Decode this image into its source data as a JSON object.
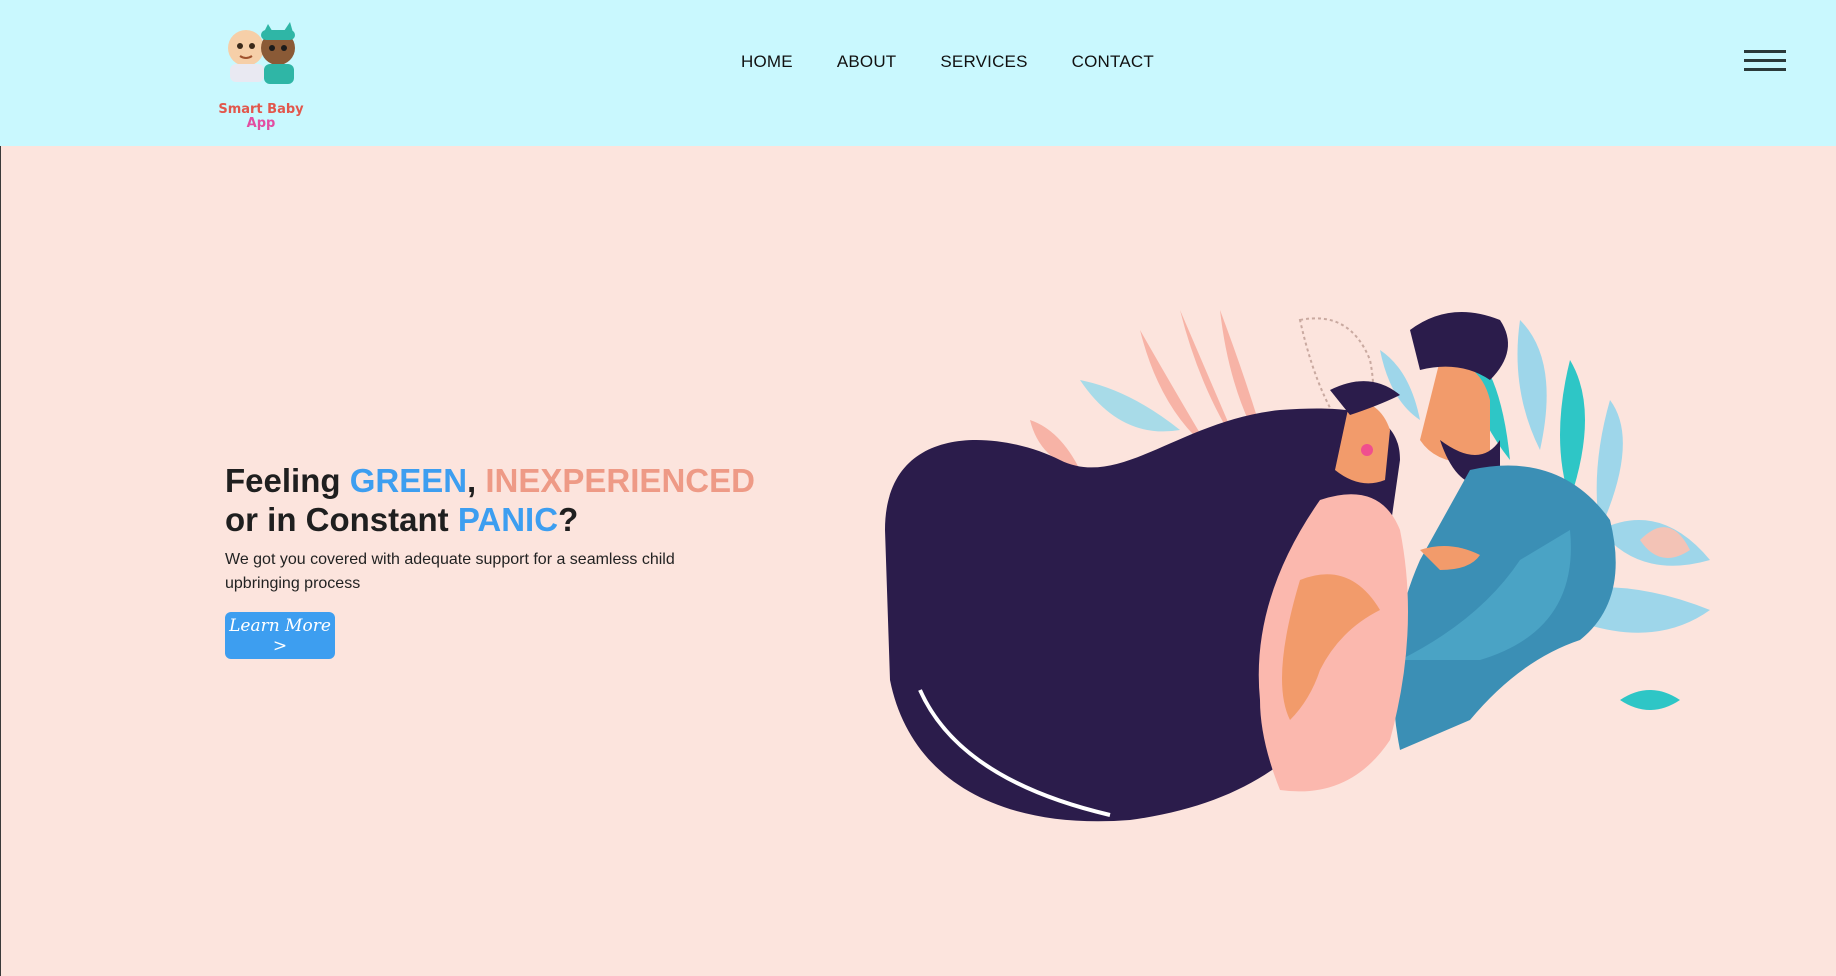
{
  "brand": {
    "logo_line1": "Smart Baby",
    "logo_line2": "App"
  },
  "nav": {
    "items": [
      {
        "label": "HOME"
      },
      {
        "label": "ABOUT"
      },
      {
        "label": "SERVICES"
      },
      {
        "label": "CONTACT"
      }
    ]
  },
  "hero": {
    "title": {
      "w1": "Feeling ",
      "w2": "GREEN",
      "w3": ", ",
      "w4": "INEXPERIENCED",
      "w5": "or in Constant ",
      "w6": "PANIC",
      "w7": "?"
    },
    "subtitle": "We got you covered with adequate support for a seamless child upbringing process",
    "cta": "Learn More >"
  },
  "colors": {
    "header_bg": "#c9f8fe",
    "page_bg": "#fce4dd",
    "accent_blue": "#3d9ef0",
    "accent_salmon": "#ee9a86"
  },
  "icons": {
    "menu": "hamburger-icon"
  }
}
